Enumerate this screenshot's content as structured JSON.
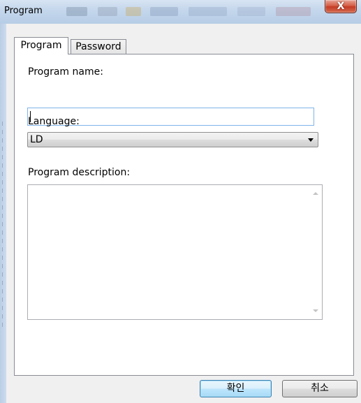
{
  "window": {
    "title": "Program",
    "close_icon": "close-x-icon",
    "close_label": "X"
  },
  "tabs": [
    {
      "label": "Program",
      "selected": true
    },
    {
      "label": "Password",
      "selected": false
    }
  ],
  "form": {
    "program_name_label": "Program name:",
    "program_name_value": "",
    "language_label": "Language:",
    "language_value": "LD",
    "description_label": "Program description:",
    "description_value": ""
  },
  "buttons": {
    "ok_label": "확인",
    "cancel_label": "취소"
  },
  "colors": {
    "titlebar": "#c3d6ec",
    "close_button": "#c43a24",
    "focus_border": "#7eb4ea",
    "default_button": "#bee6fd"
  }
}
